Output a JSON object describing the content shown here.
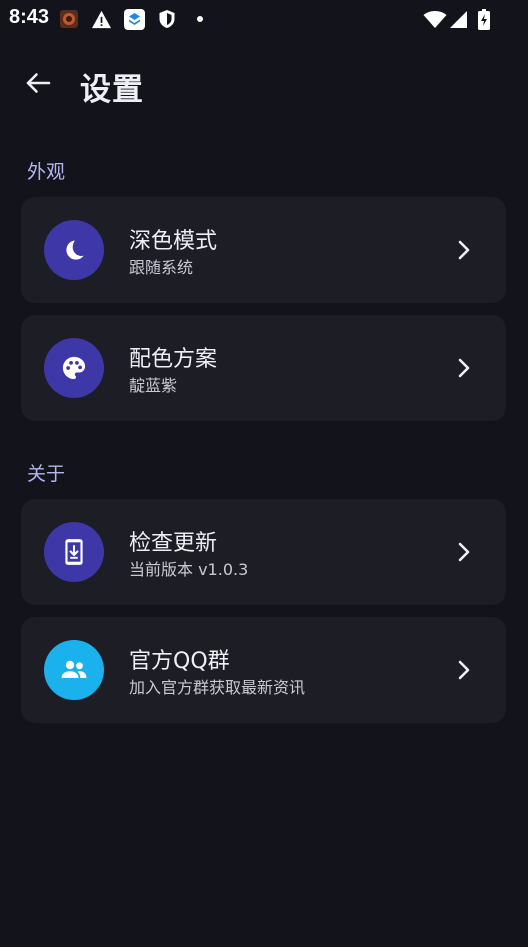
{
  "status_bar": {
    "time": "8:43"
  },
  "header": {
    "title": "设置"
  },
  "sections": [
    {
      "header": "外观",
      "items": [
        {
          "title": "深色模式",
          "subtitle": "跟随系统",
          "icon": "moon-icon",
          "icon_bg": "#3d37a8"
        },
        {
          "title": "配色方案",
          "subtitle": "靛蓝紫",
          "icon": "palette-icon",
          "icon_bg": "#3d37a8"
        }
      ]
    },
    {
      "header": "关于",
      "items": [
        {
          "title": "检查更新",
          "subtitle": "当前版本 v1.0.3",
          "icon": "system-update-icon",
          "icon_bg": "#3d37a8"
        },
        {
          "title": "官方QQ群",
          "subtitle": "加入官方群获取最新资讯",
          "icon": "group-icon",
          "icon_bg": "#1bb1ec"
        }
      ]
    }
  ],
  "colors": {
    "background": "#13141b",
    "card": "#1d1e25",
    "accent": "#b7b4f2"
  }
}
